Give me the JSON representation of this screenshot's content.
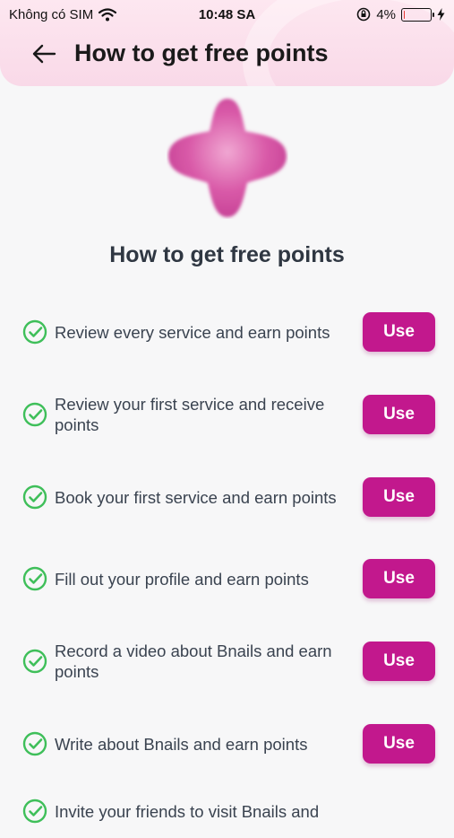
{
  "status_bar": {
    "carrier": "Không có SIM",
    "time": "10:48 SA",
    "battery_percent": "4%",
    "battery_level": 0.04
  },
  "header": {
    "title": "How to get free points",
    "back_icon": "arrow-left-icon"
  },
  "page": {
    "title": "How to get free points",
    "hero_icon": "sparkle-star-icon"
  },
  "colors": {
    "accent": "#c2188d",
    "check": "#3fbf5a",
    "header_bg": "#fbe0ec"
  },
  "tasks": [
    {
      "text": "Review every service and earn points",
      "button": "Use"
    },
    {
      "text": "Review your first service and receive points",
      "button": "Use"
    },
    {
      "text": "Book your first service and earn points",
      "button": "Use"
    },
    {
      "text": "Fill out your profile and earn points",
      "button": "Use"
    },
    {
      "text": "Record a video about Bnails and earn points",
      "button": "Use"
    },
    {
      "text": "Write about Bnails and earn points",
      "button": "Use"
    },
    {
      "text": "Invite your friends to visit Bnails and"
    }
  ]
}
